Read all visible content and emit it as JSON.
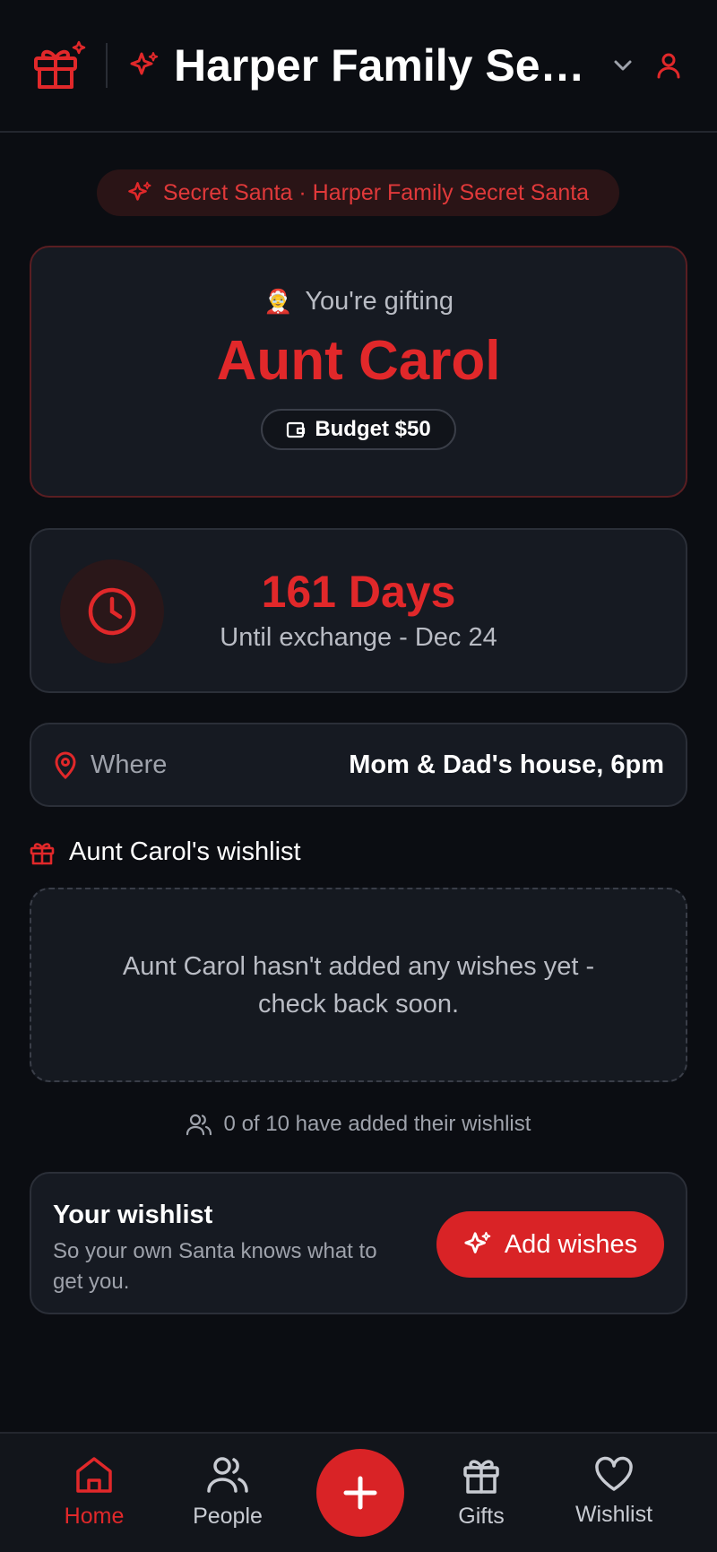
{
  "header": {
    "title": "Harper Family Secret Santa"
  },
  "pill": {
    "text": "Secret Santa · Harper Family Secret Santa"
  },
  "gifting": {
    "label": "You're gifting",
    "emoji": "🤶",
    "name": "Aunt Carol",
    "budget": "Budget $50"
  },
  "countdown": {
    "days": "161 Days",
    "subtitle": "Until exchange - Dec 24"
  },
  "location": {
    "label": "Where",
    "value": "Mom & Dad's house, 6pm"
  },
  "recipient_wishlist": {
    "heading": "Aunt Carol's wishlist",
    "empty_message": "Aunt Carol hasn't added any wishes yet - check back soon."
  },
  "participation": {
    "text": "0 of 10 have added their wishlist"
  },
  "your_wishlist": {
    "title": "Your wishlist",
    "subtitle": "So your own Santa knows what to get you.",
    "button_label": "Add wishes"
  },
  "nav": {
    "home": "Home",
    "people": "People",
    "gifts": "Gifts",
    "wishlist": "Wishlist"
  },
  "colors": {
    "accent": "#e1282a",
    "background": "#0b0d12",
    "card": "#161a22"
  }
}
